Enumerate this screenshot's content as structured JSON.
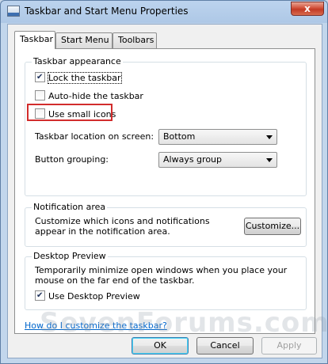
{
  "window": {
    "title": "Taskbar and Start Menu Properties",
    "close_label": "x"
  },
  "tabs": [
    {
      "label": "Taskbar",
      "active": true
    },
    {
      "label": "Start Menu",
      "active": false
    },
    {
      "label": "Toolbars",
      "active": false
    }
  ],
  "appearance": {
    "legend": "Taskbar appearance",
    "lock": {
      "label": "Lock the taskbar",
      "checked": true
    },
    "autohide": {
      "label": "Auto-hide the taskbar",
      "checked": false
    },
    "small_icons": {
      "label": "Use small icons",
      "checked": false
    },
    "location_label": "Taskbar location on screen:",
    "location_value": "Bottom",
    "grouping_label": "Button grouping:",
    "grouping_value": "Always group"
  },
  "notification": {
    "legend": "Notification area",
    "description": "Customize which icons and notifications appear in the notification area.",
    "customize_label": "Customize..."
  },
  "preview": {
    "legend": "Desktop Preview",
    "description": "Temporarily minimize open windows when you place your mouse on the far end of the taskbar.",
    "use_label": "Use Desktop Preview",
    "checked": true
  },
  "help_link": "How do I customize the taskbar?",
  "buttons": {
    "ok": "OK",
    "cancel": "Cancel",
    "apply": "Apply"
  },
  "watermark": "SevenForums.com",
  "colors": {
    "highlight": "#d22c2c",
    "link": "#0066cc",
    "close": "#c23a25"
  }
}
